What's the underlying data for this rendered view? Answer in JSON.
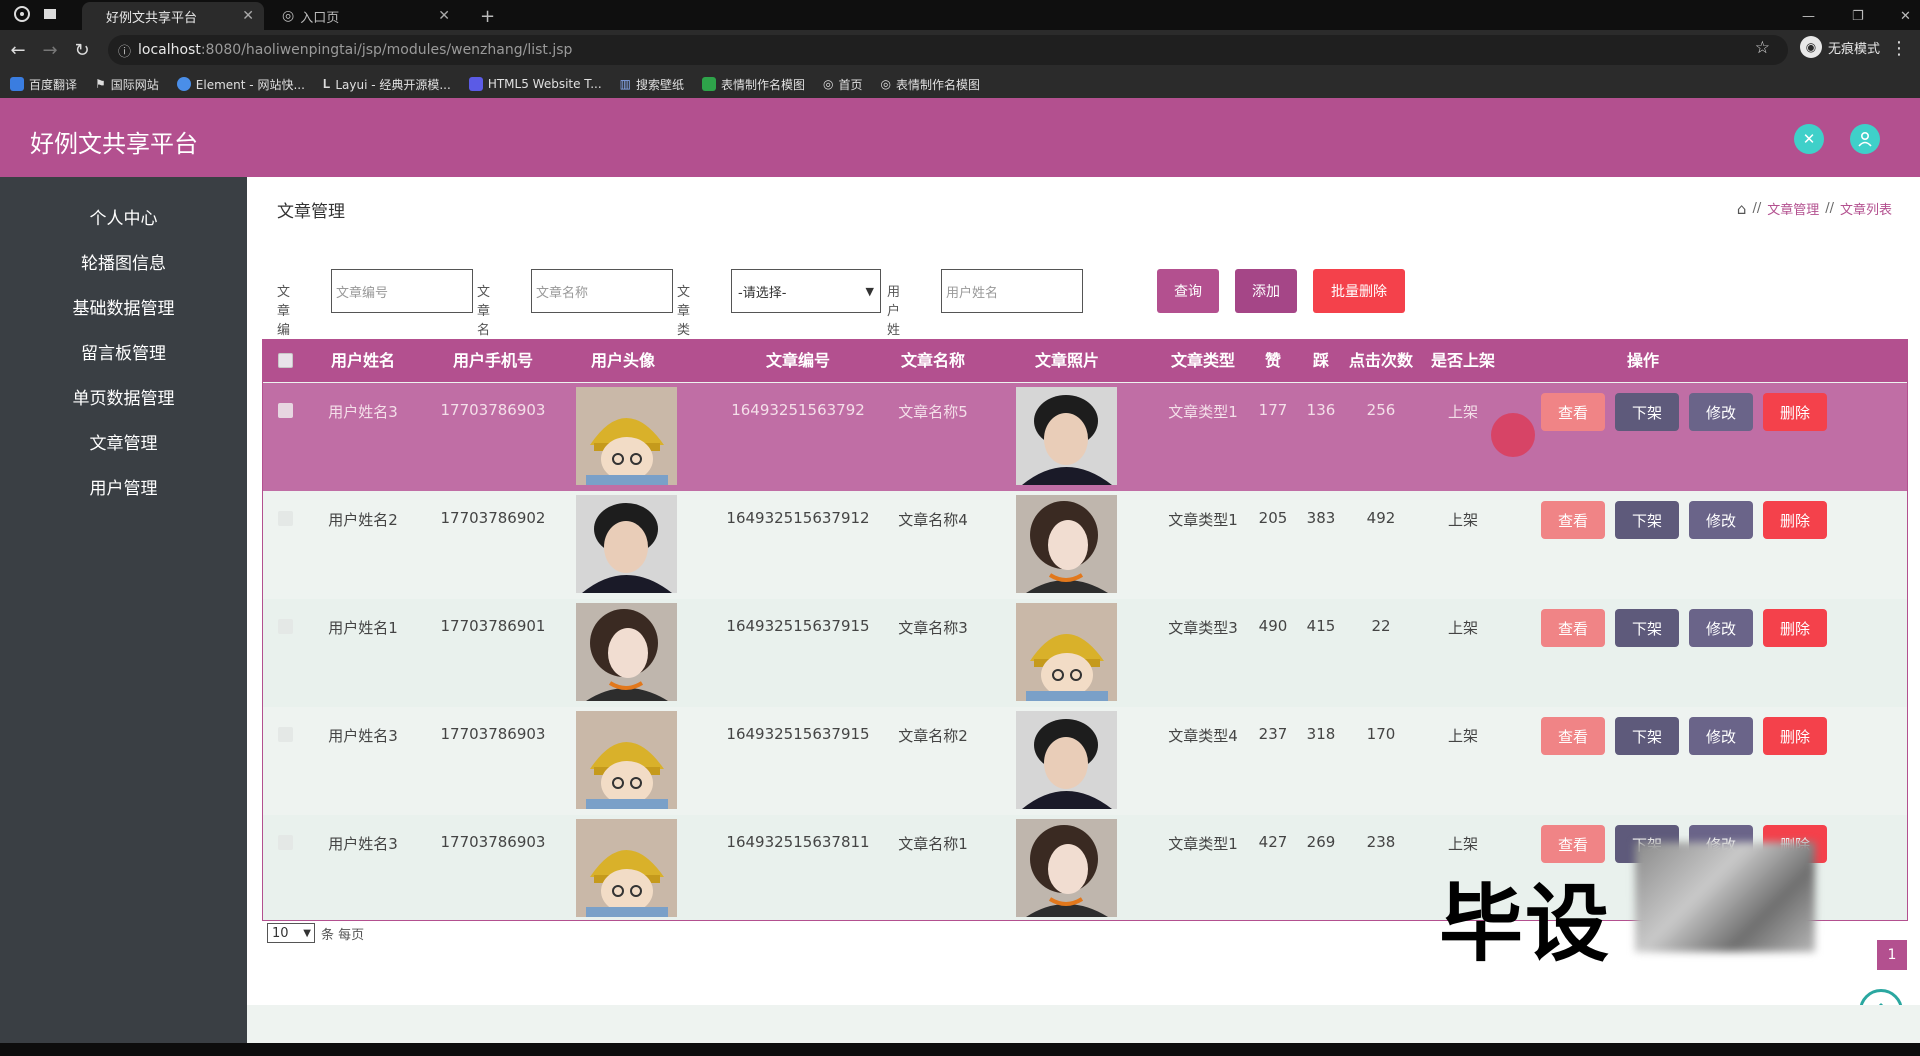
{
  "browser": {
    "tabs": [
      {
        "label": "好例文共享平台",
        "active": true
      },
      {
        "label": "入口页",
        "active": false
      }
    ],
    "new_tab": "+",
    "url_host": "localhost",
    "url_path": ":8080/haoliwenpingtai/jsp/modules/wenzhang/list.jsp",
    "incognito_label": "无痕模式",
    "bookmarks": [
      "百度翻译",
      "国际网站",
      "Element - 网站快...",
      "Layui - 经典开源模...",
      "HTML5 Website T...",
      "搜索壁纸",
      "表情制作名模图",
      "首页",
      "表情制作名模图"
    ]
  },
  "app": {
    "title": "好例文共享平台"
  },
  "sidebar": {
    "items": [
      "个人中心",
      "轮播图信息",
      "基础数据管理",
      "留言板管理",
      "单页数据管理",
      "文章管理",
      "用户管理"
    ]
  },
  "main": {
    "page_title": "文章管理",
    "breadcrumb": [
      "文章管理",
      "文章列表"
    ],
    "search": {
      "fields": [
        {
          "label": "文章编号",
          "placeholder": "文章编号"
        },
        {
          "label": "文章名称",
          "placeholder": "文章名称"
        },
        {
          "label": "文章类型",
          "value": "-请选择-"
        },
        {
          "label": "用户姓名",
          "placeholder": "用户姓名"
        }
      ],
      "query_btn": "查询",
      "add_btn": "添加",
      "batch_delete_btn": "批量删除"
    },
    "table": {
      "headers": [
        "用户姓名",
        "用户手机号",
        "用户头像",
        "文章编号",
        "文章名称",
        "文章照片",
        "文章类型",
        "赞",
        "踩",
        "点击次数",
        "是否上架",
        "操作"
      ],
      "rows": [
        {
          "name": "用户姓名3",
          "phone": "17703786903",
          "code": "16493251563792",
          "title": "文章名称5",
          "type": "文章类型1",
          "like": "177",
          "dislike": "136",
          "clicks": "256",
          "status": "上架"
        },
        {
          "name": "用户姓名2",
          "phone": "17703786902",
          "code": "164932515637912",
          "title": "文章名称4",
          "type": "文章类型1",
          "like": "205",
          "dislike": "383",
          "clicks": "492",
          "status": "上架"
        },
        {
          "name": "用户姓名1",
          "phone": "17703786901",
          "code": "164932515637915",
          "title": "文章名称3",
          "type": "文章类型3",
          "like": "490",
          "dislike": "415",
          "clicks": "22",
          "status": "上架"
        },
        {
          "name": "用户姓名3",
          "phone": "17703786903",
          "code": "164932515637915",
          "title": "文章名称2",
          "type": "文章类型4",
          "like": "237",
          "dislike": "318",
          "clicks": "170",
          "status": "上架"
        },
        {
          "name": "用户姓名3",
          "phone": "17703786903",
          "code": "164932515637811",
          "title": "文章名称1",
          "type": "文章类型1",
          "like": "427",
          "dislike": "269",
          "clicks": "238",
          "status": "上架"
        }
      ],
      "actions": {
        "view": "查看",
        "off": "下架",
        "edit": "修改",
        "delete": "删除"
      }
    },
    "pager": {
      "page_size": "10",
      "suffix": "条 每页",
      "current_page": "1"
    },
    "watermark": "毕设"
  },
  "colors": {
    "accent": "#b3508f",
    "sidebar": "#3a3f44",
    "delete": "#f4414b",
    "view": "#f08486"
  }
}
